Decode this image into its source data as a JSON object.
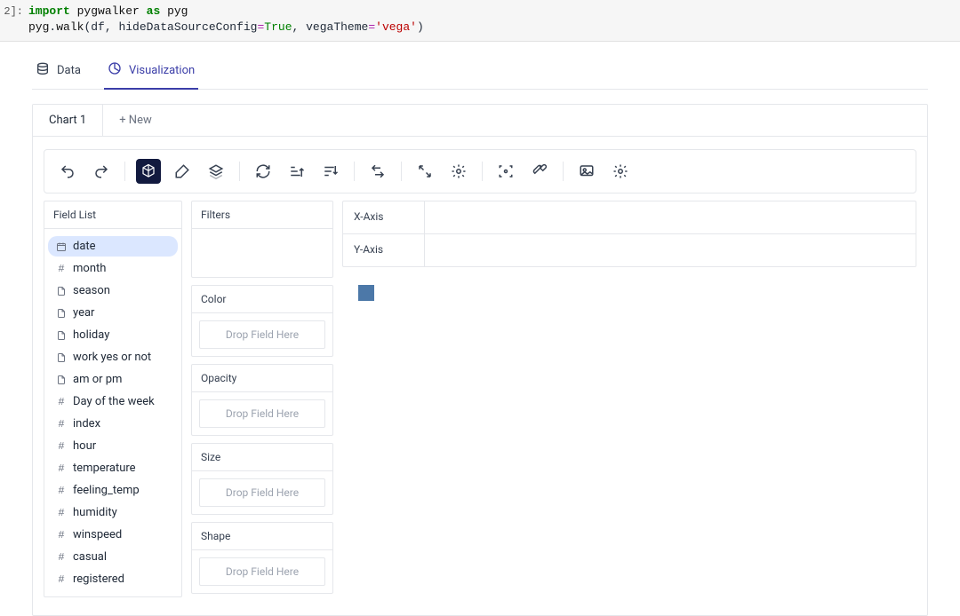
{
  "cell_prompt": "2]:",
  "code": {
    "line1_import": "import",
    "line1_mod": "pygwalker",
    "line1_as": "as",
    "line1_alias": "pyg",
    "line2_prefix": "pyg",
    "line2_dot": ".",
    "line2_fn": "walk",
    "line2_open": "(df, hideDataSourceConfig",
    "line2_eq": "=",
    "line2_true": "True",
    "line2_mid": ", vegaTheme",
    "line2_eq2": "=",
    "line2_str": "'vega'",
    "line2_close": ")"
  },
  "top_tabs": {
    "data": "Data",
    "viz": "Visualization"
  },
  "chart_tabs": {
    "active": "Chart 1",
    "new": "+ New"
  },
  "panels": {
    "field_list": "Field List",
    "filters": "Filters",
    "color": "Color",
    "opacity": "Opacity",
    "size": "Size",
    "shape": "Shape",
    "x_axis": "X-Axis",
    "y_axis": "Y-Axis"
  },
  "drop_placeholder": "Drop Field Here",
  "fields": [
    {
      "name": "date",
      "type": "date",
      "selected": true
    },
    {
      "name": "month",
      "type": "quant"
    },
    {
      "name": "season",
      "type": "nominal"
    },
    {
      "name": "year",
      "type": "nominal"
    },
    {
      "name": "holiday",
      "type": "nominal"
    },
    {
      "name": "work yes or not",
      "type": "nominal"
    },
    {
      "name": "am or pm",
      "type": "nominal"
    },
    {
      "name": "Day of the week",
      "type": "quant"
    },
    {
      "name": "index",
      "type": "quant"
    },
    {
      "name": "hour",
      "type": "quant"
    },
    {
      "name": "temperature",
      "type": "quant"
    },
    {
      "name": "feeling_temp",
      "type": "quant"
    },
    {
      "name": "humidity",
      "type": "quant"
    },
    {
      "name": "winspeed",
      "type": "quant"
    },
    {
      "name": "casual",
      "type": "quant"
    },
    {
      "name": "registered",
      "type": "quant"
    }
  ],
  "chart_data": {
    "type": "bar",
    "title": "",
    "categories": [],
    "values": [],
    "xlabel": "",
    "ylabel": ""
  }
}
